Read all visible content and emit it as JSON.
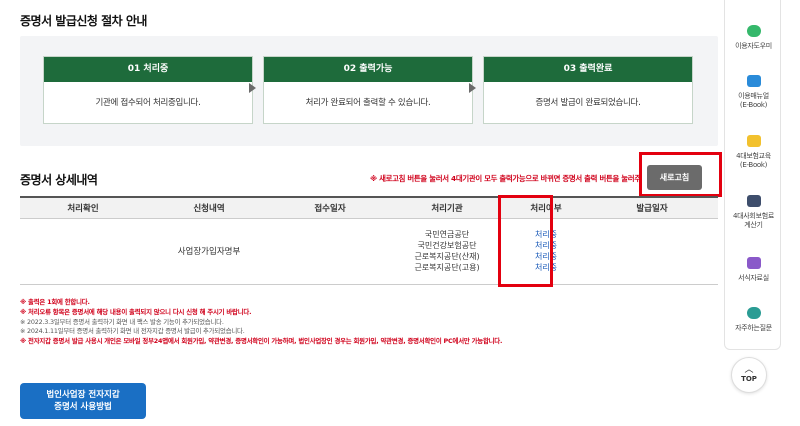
{
  "procedure": {
    "title": "증명서 발급신청 절차 안내",
    "steps": [
      {
        "label": "01 처리중",
        "desc": "기관에 접수되어 처리중입니다."
      },
      {
        "label": "02 출력가능",
        "desc": "처리가 완료되어 출력할 수 있습니다."
      },
      {
        "label": "03 출력완료",
        "desc": "증명서 발급이 완료되었습니다."
      }
    ]
  },
  "detail": {
    "title": "증명서 상세내역",
    "notice": "※ 새로고침 버튼을 눌러서 4대기관이 모두 출력가능으로 바뀌면 증명서 출력 버튼을 눌러주세요.",
    "refresh_label": "새로고침",
    "columns": [
      "처리확인",
      "신청내역",
      "접수일자",
      "처리기관",
      "처리여부",
      "발급일자"
    ],
    "row": {
      "confirm": "",
      "request": "사업장가입자명부",
      "received_date": "",
      "agencies": [
        "국민연금공단",
        "국민건강보험공단",
        "근로복지공단(산재)",
        "근로복지공단(고용)"
      ],
      "statuses": [
        "처리중",
        "처리중",
        "처리중",
        "처리중"
      ],
      "issue_date": ""
    }
  },
  "notes": [
    {
      "text": "※ 출력은 1회에 한합니다.",
      "style": "red"
    },
    {
      "text": "※ 처리오류 항목은 증명서에 해당 내용이 출력되지 않으니 다시 신청 해 주시기 바랍니다.",
      "style": "red"
    },
    {
      "text": "※ 2022.3.3일부터 증명서 출력하기 화면 내 팩스 발송 기능이 추가되었습니다.",
      "style": "gray"
    },
    {
      "text": "※ 2024.1.11일부터 증명서 출력하기 화면 내 전자지갑 증명서 발급이 추가되었습니다.",
      "style": "gray"
    },
    {
      "text": "※ 전자지갑 증명서 발급 사용시 개인은 모바일 정부24앱에서 회원가입, 약관변경, 증명서확인이 가능하며, 법인사업장인 경우는 회원가입, 약관변경, 증명서확인이 PC에서만 가능합니다.",
      "style": "red"
    }
  ],
  "guide_button": {
    "line1": "법인사업장 전자지갑",
    "line2": "증명서 사용방법"
  },
  "sidebar": {
    "items": [
      {
        "label": "이용자도우미",
        "icon": "chat-icon",
        "color": "#35b86b"
      },
      {
        "label": "이용매뉴얼\n(E-Book)",
        "icon": "manual-icon",
        "color": "#2a8bd9"
      },
      {
        "label": "4대보험교육\n(E-Book)",
        "icon": "education-icon",
        "color": "#f2c12e"
      },
      {
        "label": "4대사회보험료\n계산기",
        "icon": "calculator-icon",
        "color": "#3e4e6c"
      },
      {
        "label": "서식자료실",
        "icon": "folder-icon",
        "color": "#8a59c9"
      },
      {
        "label": "자주하는질문",
        "icon": "faq-icon",
        "color": "#2a9c94"
      }
    ],
    "top_label": "TOP"
  }
}
